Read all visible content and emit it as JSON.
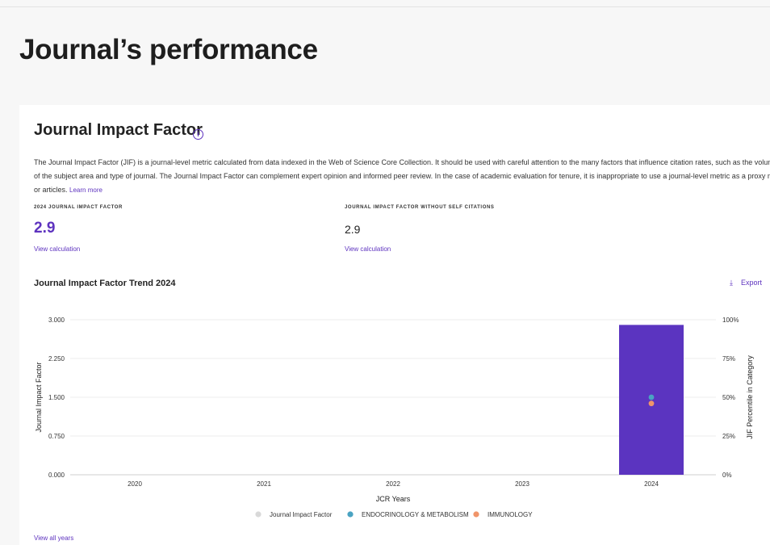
{
  "page": {
    "title": "Journal’s performance"
  },
  "jif_section": {
    "title": "Journal Impact Factor",
    "description": "The Journal Impact Factor (JIF) is a journal-level metric calculated from data indexed in the Web of Science Core Collection. It should be used with careful attention to the many factors that influence citation rates, such as the volume of publication and citations characteristics of the subject area and type of journal. The Journal Impact Factor can complement expert opinion and informed peer review. In the case of academic evaluation for tenure, it is inappropriate to use a journal-level metric as a proxy measure for individual researchers, institutions, or articles.",
    "learn_more": "Learn more",
    "metrics": [
      {
        "label": "2024 JOURNAL IMPACT FACTOR",
        "value": "2.9",
        "link": "View calculation"
      },
      {
        "label": "JOURNAL IMPACT FACTOR WITHOUT SELF CITATIONS",
        "value": "2.9",
        "link": "View calculation"
      }
    ]
  },
  "trend": {
    "title": "Journal Impact Factor Trend 2024",
    "export_label": "Export",
    "view_all": "View all years"
  },
  "colors": {
    "accent": "#5e33bf",
    "bar": "#5b34c0",
    "endocrinology": "#4aa3c2",
    "immunology": "#f0956a",
    "jif_legend": "#d9d9d9"
  },
  "chart_data": {
    "type": "bar",
    "categories": [
      "2020",
      "2021",
      "2022",
      "2023",
      "2024"
    ],
    "series": [
      {
        "name": "Journal Impact Factor",
        "values": [
          null,
          null,
          null,
          null,
          2.9
        ]
      }
    ],
    "percentile_series": [
      {
        "name": "ENDOCRINOLOGY & METABOLISM",
        "values": [
          null,
          null,
          null,
          null,
          50
        ]
      },
      {
        "name": "IMMUNOLOGY",
        "values": [
          null,
          null,
          null,
          null,
          46
        ]
      }
    ],
    "xlabel": "JCR Years",
    "ylabel": "Journal Impact Factor",
    "y2label": "JIF Percentile in Category",
    "ylim": [
      0,
      3
    ],
    "y2lim": [
      0,
      100
    ],
    "yticks": [
      "0.000",
      "0.750",
      "1.500",
      "2.250",
      "3.000"
    ],
    "y2ticks": [
      "0%",
      "25%",
      "50%",
      "75%",
      "100%"
    ],
    "legend_position": "bottom",
    "grid": true
  }
}
